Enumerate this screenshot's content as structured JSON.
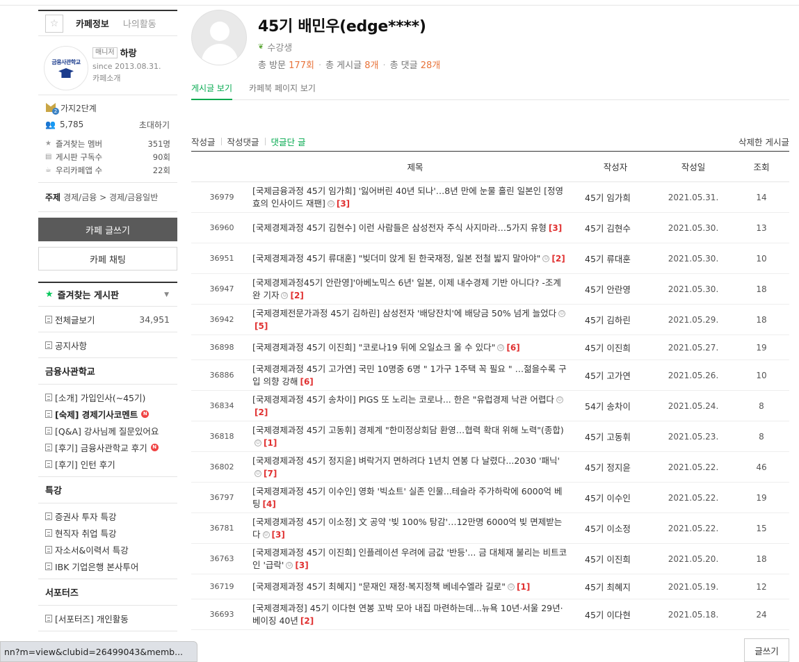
{
  "sidebar": {
    "tabs": [
      "카페정보",
      "나의활동"
    ],
    "logo_text": "금융사관학교",
    "manager_badge": "매니저",
    "manager_name": "하랑",
    "since": "since 2013.08.31.",
    "intro_link": "카페소개",
    "level": "가지2단계",
    "member_count": "5,785",
    "invite": "초대하기",
    "stats": [
      {
        "label": "즐겨찾는 멤버",
        "value": "351명",
        "icon": "star-icon"
      },
      {
        "label": "게시판 구독수",
        "value": "90회",
        "icon": "rss-icon"
      },
      {
        "label": "우리카페앱 수",
        "value": "22회",
        "icon": "app-icon"
      }
    ],
    "topic_label": "주제",
    "topic_value": "경제/금융 > 경제/금융일반",
    "write_button": "카페 글쓰기",
    "chat_button": "카페 채팅",
    "favorites_title": "즐겨찾는 게시판",
    "all_posts": {
      "label": "전체글보기",
      "count": "34,951"
    },
    "notice": "공지사항",
    "section_academy": "금융사관학교",
    "academy_items": [
      {
        "label": "[소개] 가입인사(~45기)",
        "bold": false,
        "new": false
      },
      {
        "label": "[숙제] 경제기사코멘트",
        "bold": true,
        "new": true
      },
      {
        "label": "[Q&A] 강사님께 질문있어요",
        "bold": false,
        "new": false
      },
      {
        "label": "[후기] 금융사관학교 후기",
        "bold": false,
        "new": true
      },
      {
        "label": "[후기] 인턴 후기",
        "bold": false,
        "new": false
      }
    ],
    "section_lecture": "특강",
    "lecture_items": [
      "증권사 투자 특강",
      "현직자 취업 특강",
      "자소서&이력서 특강",
      "IBK 기업은행 본사투어"
    ],
    "section_supporters": "서포터즈",
    "supporter_items": [
      "[서포터즈] 개인활동"
    ],
    "new_badge": "N"
  },
  "profile": {
    "name": "45기 배민우(edge****)",
    "role": "수강생",
    "visits_label": "총 방문",
    "visits": "177회",
    "posts_label": "총 게시글",
    "posts": "8개",
    "comments_label": "총 댓글",
    "comments": "28개"
  },
  "tabs": [
    "게시글 보기",
    "카페북 페이지 보기"
  ],
  "filters": [
    "작성글",
    "작성댓글",
    "댓글단 글"
  ],
  "deleted_posts": "삭제한 게시글",
  "table": {
    "headers": [
      "제목",
      "작성자",
      "작성일",
      "조회"
    ],
    "rows": [
      {
        "no": "36979",
        "title": "[국제금융과정 45기 임가희] '잃어버린 40년 되나'…8년 만에 눈물 흘린 일본인 [정영효의 인사이드 재팬]",
        "attach": true,
        "comments": "[3]",
        "author": "45기 임가희",
        "date": "2021.05.31.",
        "views": "14"
      },
      {
        "no": "36960",
        "title": "[국제경제과정 45기 김현수] 이런 사람들은 삼성전자 주식 사지마라…5가지 유형",
        "attach": false,
        "comments": "[3]",
        "author": "45기 김현수",
        "date": "2021.05.30.",
        "views": "13"
      },
      {
        "no": "36951",
        "title": "[국제경제과정 45기 류대훈] \"빚더미 앉게 된 한국재정, 일본 전철 밟지 말아야\"",
        "attach": true,
        "comments": "[2]",
        "author": "45기 류대훈",
        "date": "2021.05.30.",
        "views": "10"
      },
      {
        "no": "36947",
        "title": "[국제경제과정45기 안란영]'아베노믹스 6년' 일본, 이제 내수경제 기반 아니다? -조계완 기자",
        "attach": true,
        "comments": "[2]",
        "author": "45기 안란영",
        "date": "2021.05.30.",
        "views": "18"
      },
      {
        "no": "36942",
        "title": "[국제경제전문가과정 45기 김하린] 삼성전자 '배당잔치'에 배당금 50% 넘게 늘었다",
        "attach": true,
        "comments": "[5]",
        "author": "45기 김하린",
        "date": "2021.05.29.",
        "views": "18"
      },
      {
        "no": "36898",
        "title": "[국제경제과정 45기 이진희] \"코로나19 뒤에 오일쇼크 올 수 있다\"",
        "attach": true,
        "comments": "[6]",
        "author": "45기 이진희",
        "date": "2021.05.27.",
        "views": "19"
      },
      {
        "no": "36886",
        "title": "[국제경제과정 45기 고가연] 국민 10명중 6명 \" 1가구 1주택 꼭 필요 \" …젊을수록 구입 의향 강해",
        "attach": false,
        "comments": "[6]",
        "author": "45기 고가연",
        "date": "2021.05.26.",
        "views": "10"
      },
      {
        "no": "36834",
        "title": "[국제경제과정 45기 송차이] PIGS 또 노리는 코로나... 한은 \"유럽경제 낙관 어렵다",
        "attach": true,
        "comments": "[2]",
        "author": "54기 송차이",
        "date": "2021.05.24.",
        "views": "8"
      },
      {
        "no": "36818",
        "title": "[국제경제과정 45기 고동휘] 경제계 \"한미정상회담 환영…협력 확대 위해 노력\"(종합)",
        "attach": true,
        "comments": "[1]",
        "author": "45기 고동휘",
        "date": "2021.05.23.",
        "views": "8"
      },
      {
        "no": "36802",
        "title": "[국제경제과정 45기 정지윤] 벼락거지 면하려다 1년치 연봉 다 날렸다...2030 '패닉'",
        "attach": true,
        "comments": "[7]",
        "author": "45기 정지윤",
        "date": "2021.05.22.",
        "views": "46"
      },
      {
        "no": "36797",
        "title": "[국제경제과정 45기 이수인] 영화 '빅쇼트' 실존 인물...테슬라 주가하락에 6000억 베팅",
        "attach": false,
        "comments": "[4]",
        "author": "45기 이수인",
        "date": "2021.05.22.",
        "views": "19"
      },
      {
        "no": "36781",
        "title": "[국제경제과정 45기 이소정] 文 공약 '빚 100% 탕감'…12만명 6000억 빚 면제받는다",
        "attach": true,
        "comments": "[3]",
        "author": "45기 이소정",
        "date": "2021.05.22.",
        "views": "15"
      },
      {
        "no": "36763",
        "title": "[국제경제과정 45기 이진희] 인플레이션 우려에 금값 '반등'... 금 대체재 불리는 비트코인 '급락'",
        "attach": true,
        "comments": "[3]",
        "author": "45기 이진희",
        "date": "2021.05.20.",
        "views": "18"
      },
      {
        "no": "36719",
        "title": "[국제경제과정 45기 최혜지] \"문재인 재정·복지정책 베네수엘라 길로\"",
        "attach": true,
        "comments": "[1]",
        "author": "45기 최혜지",
        "date": "2021.05.19.",
        "views": "12"
      },
      {
        "no": "36693",
        "title": "[국제경제과정] 45기 이다현 연봉 꼬박 모아 내집 마련하는데...뉴욕 10년·서울 29년·베이징 40년",
        "attach": false,
        "comments": "[2]",
        "author": "45기 이다현",
        "date": "2021.05.18.",
        "views": "24"
      }
    ]
  },
  "write_button_bottom": "글쓰기",
  "status_url": "nn?m=view&clubid=26499043&memb...",
  "colors": {
    "accent_green": "#03a94e",
    "count_orange": "#e8733a",
    "comment_red": "#e03030"
  }
}
